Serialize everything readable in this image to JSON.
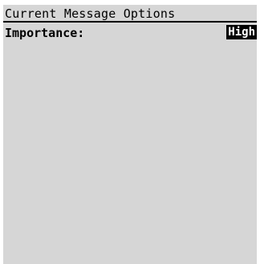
{
  "screen": {
    "title": "Current Message Options"
  },
  "options": {
    "importance": {
      "label": "Importance:",
      "value": "High"
    }
  },
  "colors": {
    "panel_background": "#d6d6d6",
    "text": "#000000",
    "selected_background": "#000000",
    "selected_text": "#ffffff"
  }
}
